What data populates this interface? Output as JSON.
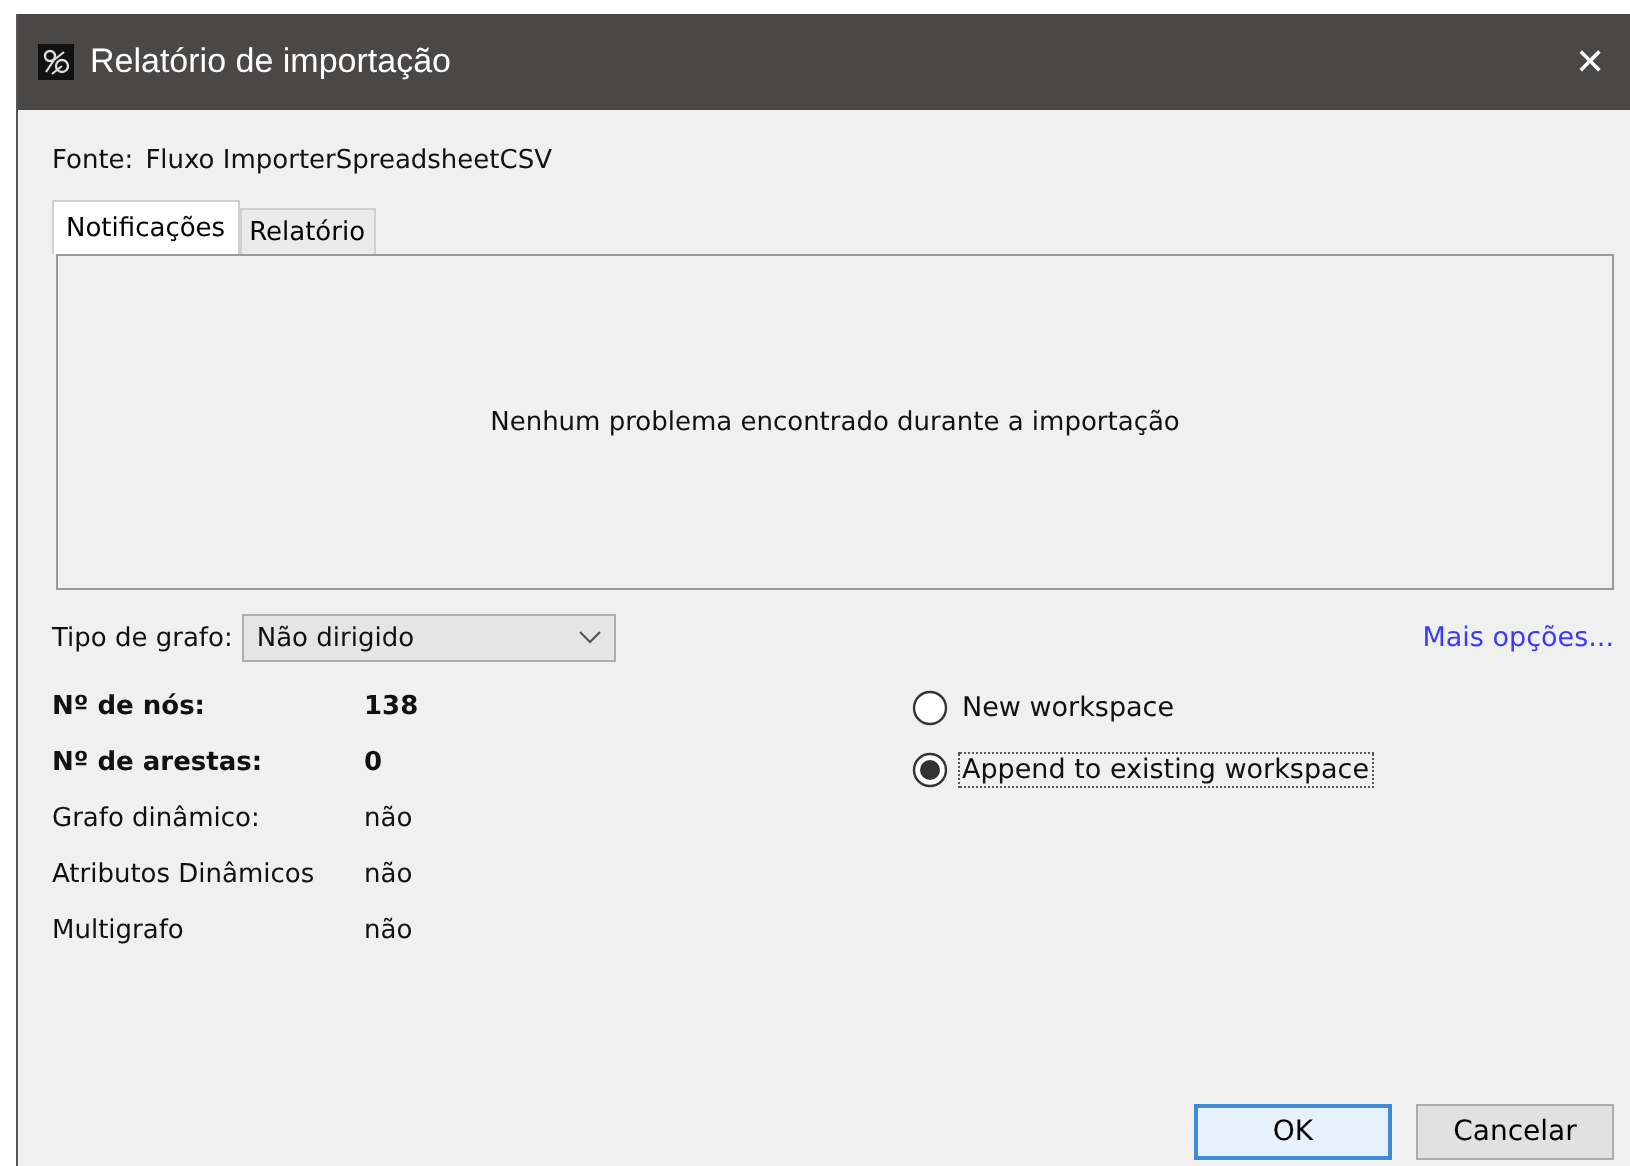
{
  "window": {
    "title": "Relatório de importação",
    "close": "✕"
  },
  "source": {
    "label": "Fonte:",
    "value": "Fluxo ImporterSpreadsheetCSV"
  },
  "tabs": [
    {
      "label": "Notificações",
      "selected": true
    },
    {
      "label": "Relatório",
      "selected": false
    }
  ],
  "notification": "Nenhum problema encontrado durante a importação",
  "graph_type": {
    "label": "Tipo de grafo:",
    "value": "Não dirigido"
  },
  "more_options": "Mais opções...",
  "stats": [
    {
      "label": "Nº de nós:",
      "value": "138",
      "kind": "bold"
    },
    {
      "label": "Nº de arestas:",
      "value": "0",
      "kind": "bold"
    },
    {
      "label": "Grafo dinâmico:",
      "value": "não",
      "kind": "plain"
    },
    {
      "label": "Atributos Dinâmicos",
      "value": "não",
      "kind": "plain"
    },
    {
      "label": "Multigrafo",
      "value": "não",
      "kind": "plain"
    }
  ],
  "workspace_options": [
    {
      "label": "New workspace",
      "selected": false,
      "focused": false
    },
    {
      "label": "Append to existing workspace",
      "selected": true,
      "focused": true
    }
  ],
  "buttons": [
    {
      "label": "OK",
      "default": true
    },
    {
      "label": "Cancelar",
      "default": false
    }
  ]
}
